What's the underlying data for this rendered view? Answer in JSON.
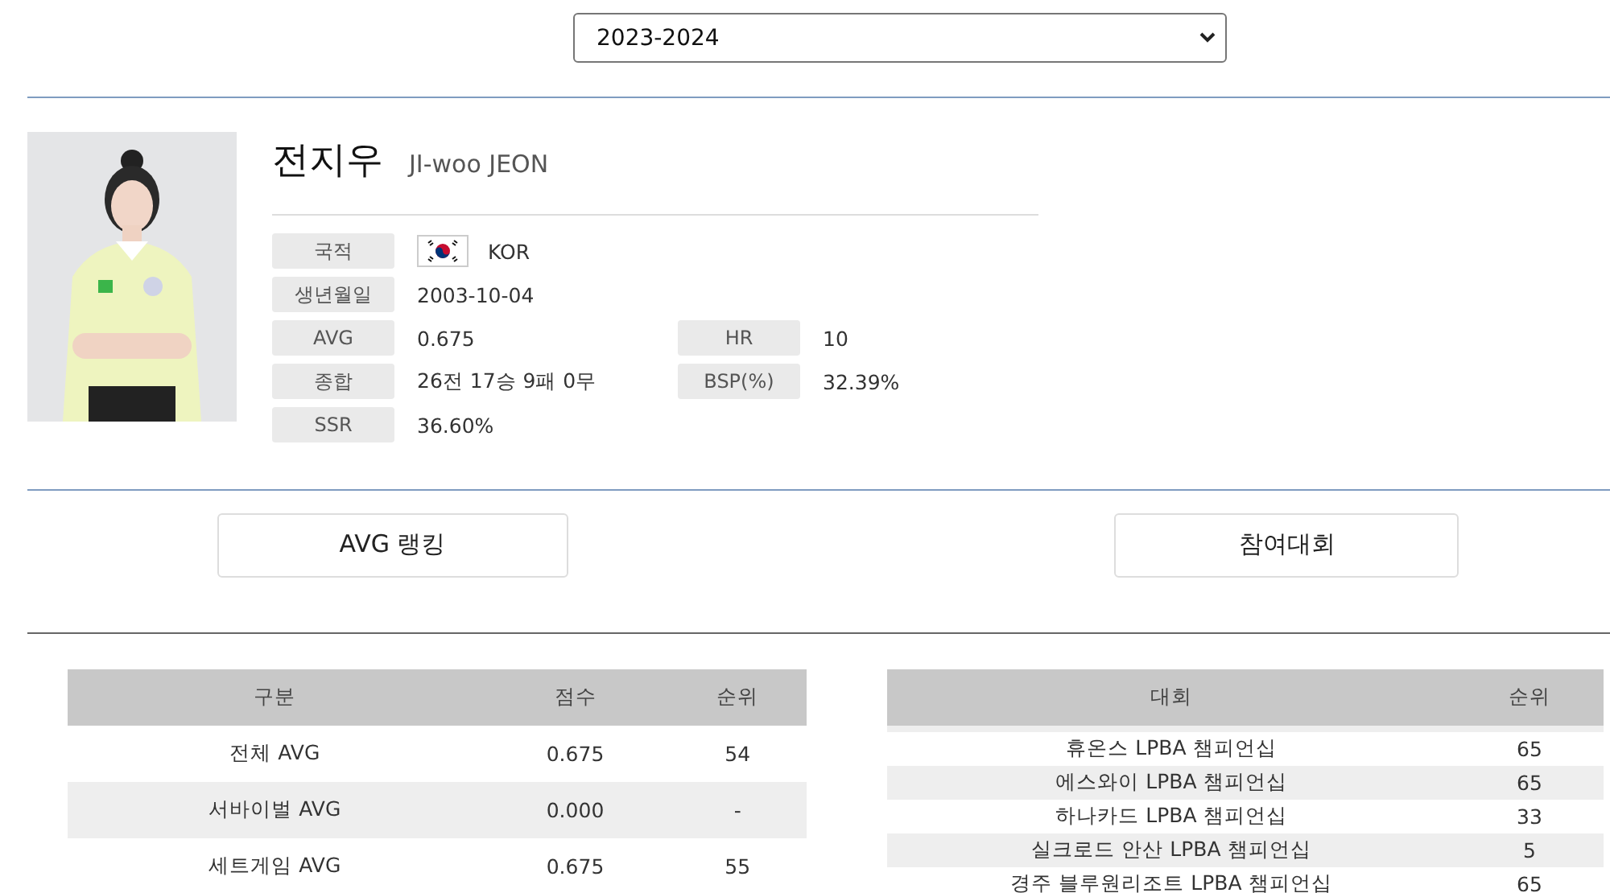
{
  "season_select": {
    "value": "2023-2024"
  },
  "player": {
    "name": "전지우",
    "name_en": "JI-woo JEON",
    "info": [
      {
        "label": "국적",
        "value": "KOR",
        "kind": "flag"
      },
      {
        "label": "생년월일",
        "value": "2003-10-04"
      },
      {
        "label": "AVG",
        "value": "0.675",
        "side": {
          "label": "HR",
          "value": "10"
        }
      },
      {
        "label": "종합",
        "value": "26전 17승 9패 0무",
        "side": {
          "label": "BSP(%)",
          "value": "32.39%"
        }
      },
      {
        "label": "SSR",
        "value": "36.60%"
      }
    ]
  },
  "buttons": [
    "AVG 랭킹",
    "참여대회"
  ],
  "avg_table": {
    "columns": [
      "구분",
      "점수",
      "순위"
    ],
    "rows": [
      [
        "전체 AVG",
        "0.675",
        "54"
      ],
      [
        "서바이벌 AVG",
        "0.000",
        "-"
      ],
      [
        "세트게임 AVG",
        "0.675",
        "55"
      ]
    ]
  },
  "tournament_table": {
    "columns": [
      "대회",
      "순위"
    ],
    "rows": [
      [
        "휴온스 LPBA 챔피언십",
        "65"
      ],
      [
        "에스와이 LPBA 챔피언십",
        "65"
      ],
      [
        "하나카드 LPBA 챔피언십",
        "33"
      ],
      [
        "실크로드 안산 LPBA 챔피언십",
        "5"
      ],
      [
        "경주 블루원리조트 LPBA 챔피언십",
        "65"
      ]
    ]
  }
}
